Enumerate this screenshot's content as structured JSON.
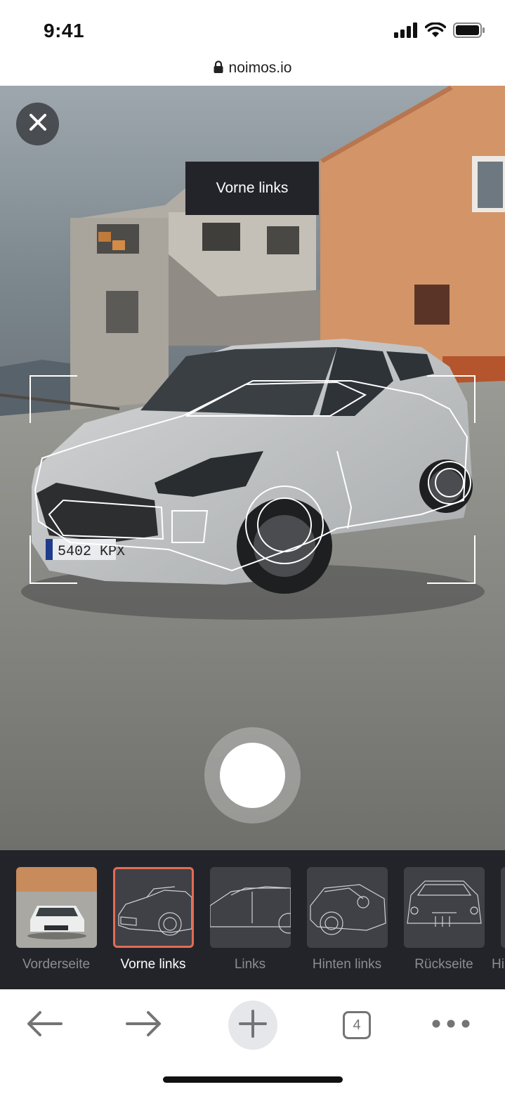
{
  "status": {
    "time": "9:41",
    "url": "noimos.io"
  },
  "camera": {
    "tooltip": "Vorne links",
    "plate": "5402 KPX"
  },
  "thumbnails": [
    {
      "label": "Vorderseite",
      "active": false
    },
    {
      "label": "Vorne links",
      "active": true
    },
    {
      "label": "Links",
      "active": false
    },
    {
      "label": "Hinten links",
      "active": false
    },
    {
      "label": "Rückseite",
      "active": false
    },
    {
      "label": "Hi",
      "active": false
    }
  ],
  "toolbar": {
    "tab_count": "4"
  },
  "colors": {
    "accent": "#e26d55",
    "strip_bg": "#23242a",
    "tooltip_bg": "#23242a"
  }
}
